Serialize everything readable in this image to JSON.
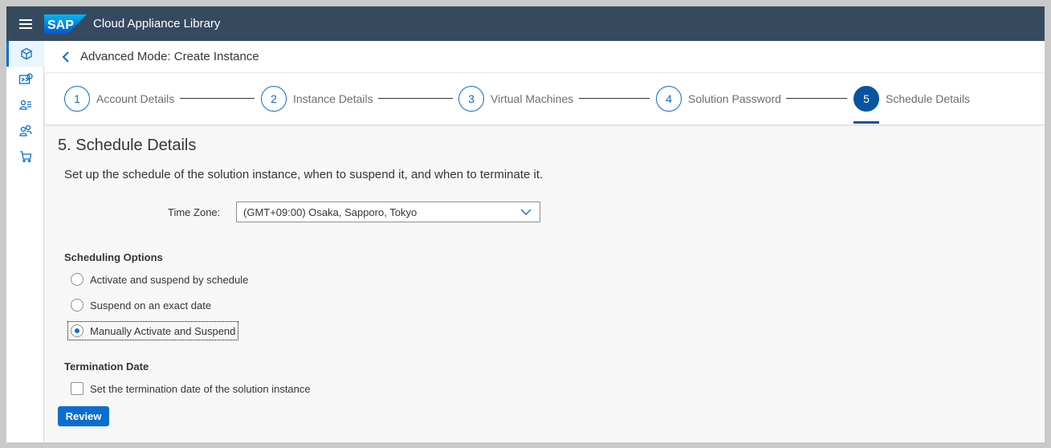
{
  "shell": {
    "brand": "SAP",
    "app_title": "Cloud Appliance Library",
    "accent_color": "#0a6ed1",
    "bar_color": "#354a5f"
  },
  "sidenav": {
    "items": [
      {
        "icon": "cube-icon",
        "active": true
      },
      {
        "icon": "solutions-icon",
        "active": false
      },
      {
        "icon": "user-list-icon",
        "active": false
      },
      {
        "icon": "group-icon",
        "active": false
      },
      {
        "icon": "cart-icon",
        "active": false
      }
    ]
  },
  "header": {
    "title": "Advanced Mode: Create Instance"
  },
  "wizard": {
    "steps": [
      {
        "number": "1",
        "label": "Account Details"
      },
      {
        "number": "2",
        "label": "Instance Details"
      },
      {
        "number": "3",
        "label": "Virtual Machines"
      },
      {
        "number": "4",
        "label": "Solution Password"
      },
      {
        "number": "5",
        "label": "Schedule Details"
      }
    ],
    "current_step": 5
  },
  "section": {
    "title": "5. Schedule Details",
    "description": "Set up the schedule of the solution instance, when to suspend it, and when to terminate it."
  },
  "timezone": {
    "label": "Time Zone:",
    "value": "(GMT+09:00) Osaka, Sapporo, Tokyo"
  },
  "scheduling": {
    "title": "Scheduling Options",
    "options": [
      {
        "label": "Activate and suspend by schedule",
        "selected": false
      },
      {
        "label": "Suspend on an exact date",
        "selected": false
      },
      {
        "label": "Manually Activate and Suspend",
        "selected": true
      }
    ]
  },
  "termination": {
    "title": "Termination Date",
    "checkbox_label": "Set the termination date of the solution instance",
    "checked": false
  },
  "actions": {
    "review_label": "Review"
  }
}
